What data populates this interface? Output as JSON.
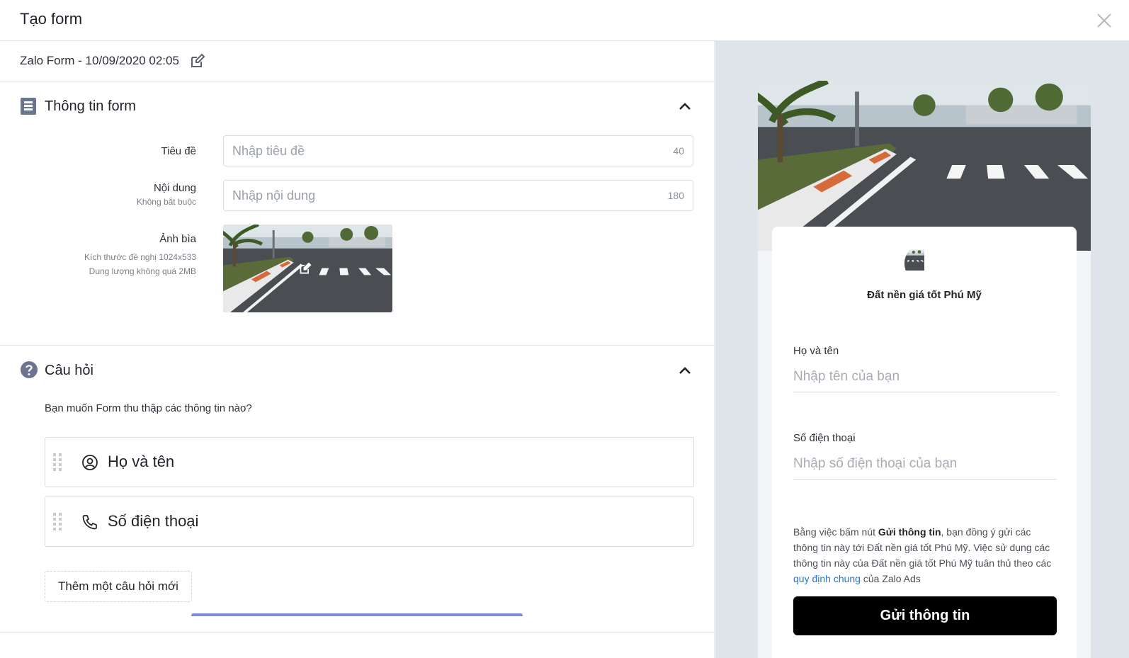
{
  "header": {
    "title": "Tạo form",
    "close_icon": "close-icon"
  },
  "form_name": "Zalo Form - 10/09/2020 02:05",
  "info_section": {
    "title": "Thông tin form",
    "icon": "form-document-icon",
    "title_field": {
      "label": "Tiêu đề",
      "placeholder": "Nhập tiêu đề",
      "value": "",
      "max": "40"
    },
    "content_field": {
      "label": "Nội dung",
      "sublabel": "Không bắt buộc",
      "placeholder": "Nhập nội dung",
      "value": "",
      "max": "180"
    },
    "cover": {
      "label": "Ảnh bìa",
      "hint1": "Kích thước đề nghị 1024x533",
      "hint2": "Dung lượng không quá 2MB"
    }
  },
  "questions_section": {
    "title": "Câu hỏi",
    "icon": "question-circle-icon",
    "prompt": "Bạn muốn Form thu thập các thông tin nào?",
    "items": [
      {
        "label": "Họ và tên",
        "icon": "user-circle-icon"
      },
      {
        "label": "Số điện thoại",
        "icon": "phone-icon"
      }
    ],
    "add_button": "Thêm một câu hỏi mới"
  },
  "preview": {
    "brand": "Đất nền giá tốt Phú Mỹ",
    "name_label": "Họ và tên",
    "name_placeholder": "Nhập tên của bạn",
    "phone_label": "Số điện thoại",
    "phone_placeholder": "Nhập số điện thoại của bạn",
    "consent": {
      "part1": "Bằng việc bấm nút ",
      "bold": "Gửi thông tin",
      "part2": ", bạn đồng ý gửi các thông tin này tới Đất nền giá tốt Phú Mỹ. Việc sử dụng các thông tin này của Đất nền giá tốt Phú Mỹ tuân thủ theo các ",
      "link": "quy định chung",
      "part3": " của Zalo Ads"
    },
    "submit": "Gửi thông tin"
  },
  "colors": {
    "preview_bg": "#dfe3ea",
    "link": "#1f77d2",
    "submit_bg": "#000000",
    "icon": "#6b7590"
  }
}
